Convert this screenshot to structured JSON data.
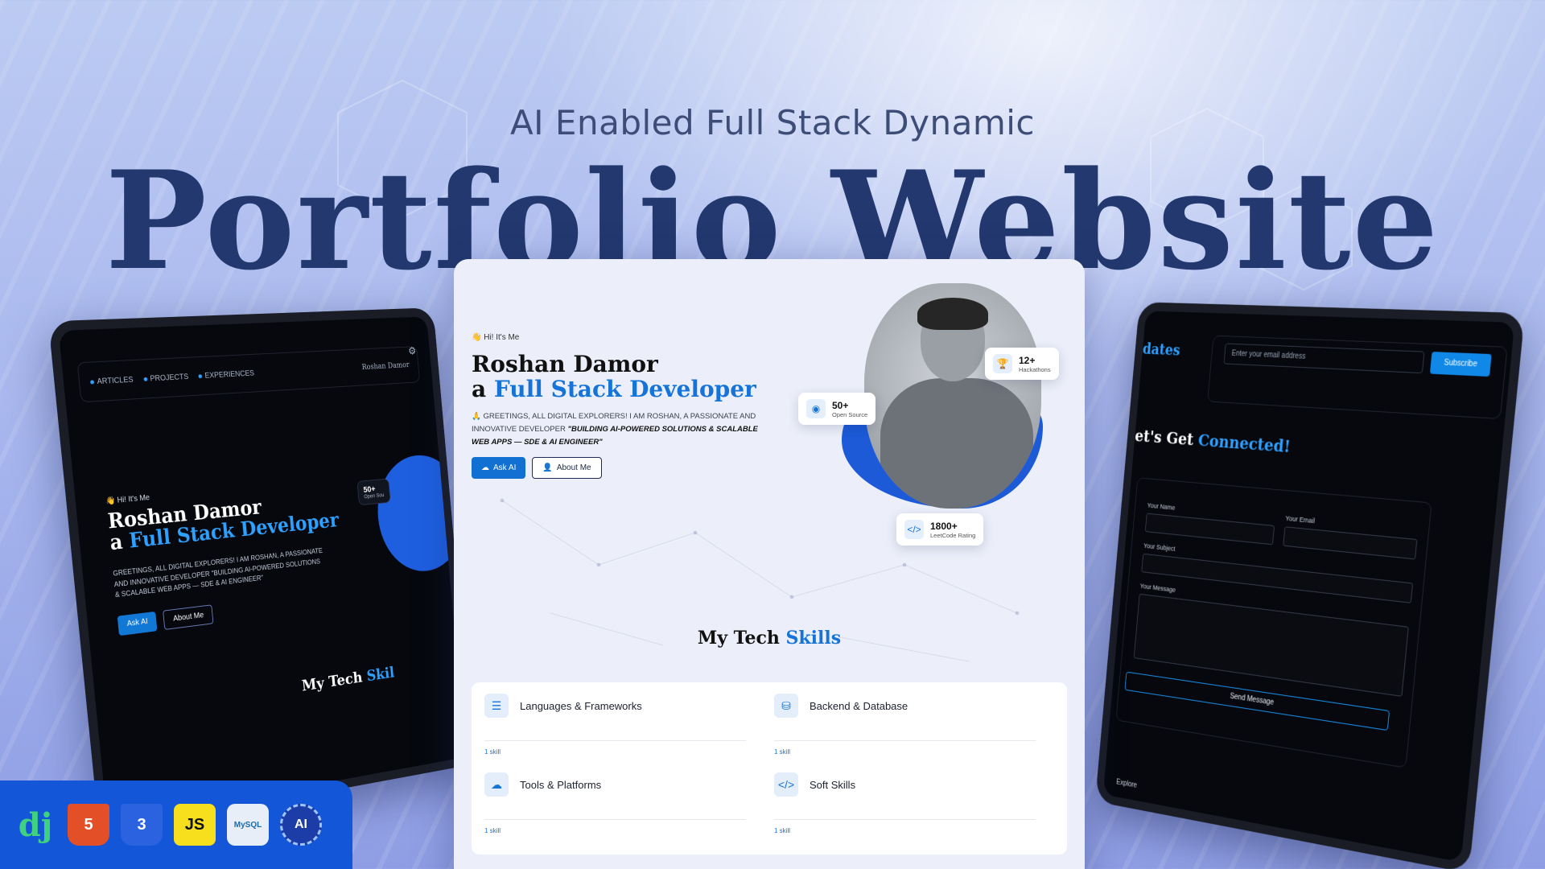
{
  "headline": {
    "subtitle": "AI Enabled Full Stack Dynamic",
    "title": "Portfolio Website"
  },
  "left_mockup": {
    "nav": [
      "ARTICLES",
      "PROJECTS",
      "EXPERIENCES"
    ],
    "brand": "Roshan Damor",
    "greeting": "Hi! It's Me",
    "name_line1": "Roshan Damor",
    "name_line2_prefix": "a ",
    "name_line2_highlight": "Full Stack Developer",
    "description": "GREETINGS, ALL DIGITAL EXPLORERS! I AM ROSHAN, A PASSIONATE AND INNOVATIVE DEVELOPER \"BUILDING AI-POWERED SOLUTIONS & SCALABLE WEB APPS — SDE & AI ENGINEER\"",
    "btn_ask": "Ask AI",
    "btn_about": "About Me",
    "badge_value": "50+",
    "badge_label": "Open Sou",
    "skills_prefix": "My Tech ",
    "skills_highlight": "Skil"
  },
  "right_mockup": {
    "updates": "dates",
    "email_placeholder": "Enter your email address",
    "subscribe": "Subscribe",
    "connect_prefix": "et's Get ",
    "connect_highlight": "Connected!",
    "label_name": "Your Name",
    "label_email": "Your Email",
    "label_subject": "Your Subject",
    "label_message": "Your Message",
    "send": "Send Message",
    "explore": "Explore"
  },
  "center_mockup": {
    "greeting": "Hi! It's Me",
    "name_line1": "Roshan Damor",
    "name_line2_prefix": "a ",
    "name_line2_highlight": "Full Stack Developer",
    "description_plain": "GREETINGS, ALL DIGITAL EXPLORERS! I AM ROSHAN, A PASSIONATE AND INNOVATIVE DEVELOPER ",
    "description_quote": "\"BUILDING AI-POWERED SOLUTIONS & SCALABLE WEB APPS — SDE & AI ENGINEER\"",
    "btn_ask": "Ask AI",
    "btn_about": "About Me",
    "stat_hackathons_value": "12+",
    "stat_hackathons_label": "Hackathons",
    "stat_opensource_value": "50+",
    "stat_opensource_label": "Open Source",
    "stat_leetcode_value": "1800+",
    "stat_leetcode_label": "LeetCode Rating",
    "skills_prefix": "My Tech ",
    "skills_highlight": "Skills",
    "skill_categories": [
      {
        "title": "Languages & Frameworks",
        "count": "1 skill"
      },
      {
        "title": "Backend & Database",
        "count": "1 skill"
      },
      {
        "title": "Tools & Platforms",
        "count": "1 skill"
      },
      {
        "title": "Soft Skills",
        "count": "1 skill"
      }
    ]
  },
  "tech_stack": {
    "django": "dj",
    "html": "5",
    "css": "3",
    "js": "JS",
    "mysql": "MySQL",
    "ai": "AI"
  },
  "colors": {
    "accent_blue": "#1674d8",
    "headline_navy": "#22386e",
    "dark_bg": "#06080e",
    "techbar_blue": "#1456d8"
  }
}
